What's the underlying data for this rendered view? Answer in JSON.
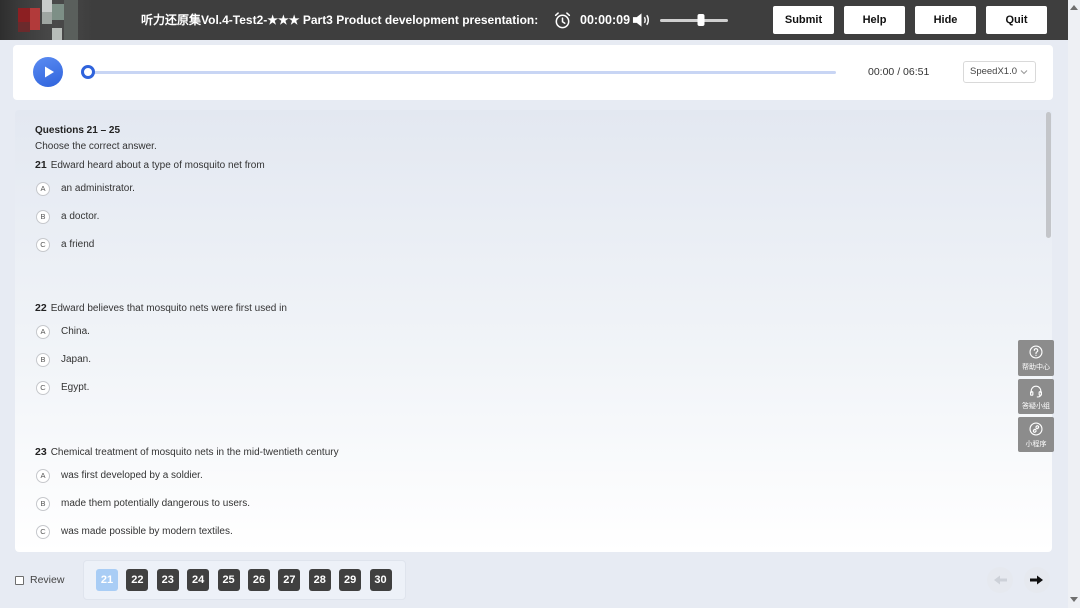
{
  "header": {
    "title": "听力还原集Vol.4-Test2-★★★ Part3 Product development presentation:",
    "timer": "00:00:09",
    "volume_level": 0.6,
    "buttons": {
      "submit": "Submit",
      "help": "Help",
      "hide": "Hide",
      "quit": "Quit"
    },
    "icons": {
      "timer": "alarm-clock-icon",
      "volume": "speaker-icon"
    }
  },
  "player": {
    "progress": 0,
    "time": "00:00 / 06:51",
    "speed": "SpeedX1.0",
    "icons": {
      "play": "play-icon",
      "speed_dropdown": "chevron-down-icon"
    }
  },
  "section": {
    "title": "Questions 21 – 25",
    "instruction": "Choose the correct answer.",
    "questions": [
      {
        "number": "21",
        "text": "Edward heard about a type of mosquito net from",
        "options": [
          {
            "letter": "A",
            "text": "an administrator."
          },
          {
            "letter": "B",
            "text": "a doctor."
          },
          {
            "letter": "C",
            "text": "a friend"
          }
        ]
      },
      {
        "number": "22",
        "text": "Edward believes that mosquito nets were first used in",
        "options": [
          {
            "letter": "A",
            "text": "China."
          },
          {
            "letter": "B",
            "text": "Japan."
          },
          {
            "letter": "C",
            "text": "Egypt."
          }
        ]
      },
      {
        "number": "23",
        "text": "Chemical treatment of mosquito nets in the mid-twentieth century",
        "options": [
          {
            "letter": "A",
            "text": "was first developed by a soldier."
          },
          {
            "letter": "B",
            "text": "made them potentially dangerous to users."
          },
          {
            "letter": "C",
            "text": "was made possible by modern textiles."
          }
        ]
      }
    ]
  },
  "side_tools": [
    {
      "label": "帮助中心",
      "icon": "help-circle-icon"
    },
    {
      "label": "答疑小组",
      "icon": "headset-icon"
    },
    {
      "label": "小程序",
      "icon": "link-icon"
    }
  ],
  "footer": {
    "review_label": "Review",
    "review_checked": false,
    "question_nav": [
      {
        "label": "21",
        "current": true
      },
      {
        "label": "22",
        "current": false
      },
      {
        "label": "23",
        "current": false
      },
      {
        "label": "24",
        "current": false
      },
      {
        "label": "25",
        "current": false
      },
      {
        "label": "26",
        "current": false
      },
      {
        "label": "27",
        "current": false
      },
      {
        "label": "28",
        "current": false
      },
      {
        "label": "29",
        "current": false
      },
      {
        "label": "30",
        "current": false
      }
    ],
    "previous_enabled": false,
    "next_enabled": true,
    "icons": {
      "previous": "arrow-left-icon",
      "next": "arrow-right-icon"
    }
  },
  "colors": {
    "accent": "#2f63dc",
    "header_background": "#3e3e3e",
    "question_button": "#404040",
    "current_question": "#a9cdf5",
    "side_tool_background": "#8c8c8c"
  }
}
